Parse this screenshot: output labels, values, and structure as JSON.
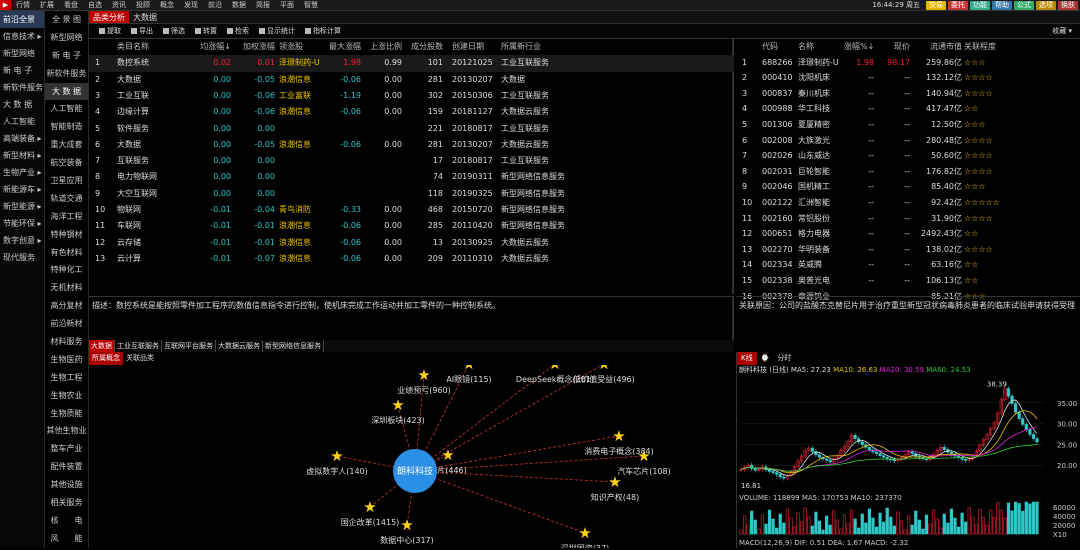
{
  "menu": {
    "items": [
      "行情",
      "扩展",
      "看盘",
      "自选",
      "资讯",
      "投顾",
      "概念",
      "发现",
      "前沿",
      "数据",
      "简报",
      "平面",
      "智慧"
    ],
    "time": "16:44:29 周五",
    "buttons": [
      {
        "label": "交易",
        "color": "#e6b800"
      },
      {
        "label": "委托",
        "color": "#c33"
      },
      {
        "label": "功能",
        "color": "#3a8"
      },
      {
        "label": "帮助",
        "color": "#37a"
      },
      {
        "label": "公式",
        "color": "#3a6"
      },
      {
        "label": "选项",
        "color": "#b80"
      },
      {
        "label": "换肤",
        "color": "#a33"
      }
    ]
  },
  "leftnav": {
    "items": [
      "前沿全景",
      "信息技术 ▸",
      "新型网络",
      "新 电 子",
      "新软件服务",
      "大 数 据",
      "人工智能",
      "高端装备 ▸",
      "新型材料 ▸",
      "生物产业 ▸",
      "新能源车 ▸",
      "新型能源 ▸",
      "节能环保 ▸",
      "数字创意 ▸",
      "现代服务"
    ],
    "active": 0
  },
  "concepts": {
    "items": [
      "全 景 图",
      "新型网络",
      "新 电 子",
      "新软件服务",
      "大 数 据",
      "人工智能",
      "智能制造",
      "重大成套",
      "航空装备",
      "卫星应用",
      "轨道交通",
      "海洋工程",
      "特种钢材",
      "有色材料",
      "特种化工",
      "无机材料",
      "高分复材",
      "前沿新材",
      "材料服务",
      "生物医药",
      "生物工程",
      "生物农业",
      "生物质能",
      "其他生物业",
      "整车产业",
      "配件装置",
      "其他设施",
      "相关服务",
      "核　　电",
      "风　　能"
    ],
    "active": 4
  },
  "tabs": [
    {
      "label": "品类分析",
      "active": true
    },
    {
      "label": "大数据",
      "active": false
    }
  ],
  "toolbar": {
    "buttons": [
      "提取",
      "导出",
      "筛选",
      "转置",
      "检索",
      "显示统计",
      "指标计算"
    ],
    "close": "收藏 ▾"
  },
  "left_table": {
    "headers": [
      "",
      "类目名称",
      "均涨幅↓",
      "加权涨幅",
      "领涨股",
      "最大涨幅",
      "上涨比例",
      "成分股数",
      "创建日期",
      "所属新行业"
    ],
    "rows": [
      [
        "1",
        "数控系统",
        "0.02",
        "0.01",
        "泽璟制药-U",
        "1.98",
        "0.99",
        "101",
        "20121025",
        "工业互联服务"
      ],
      [
        "2",
        "大数据",
        "0.00",
        "-0.05",
        "浪潮信息",
        "-0.06",
        "0.00",
        "281",
        "20130207",
        "大数据"
      ],
      [
        "3",
        "工业互联",
        "0.00",
        "-0.06",
        "工业富联",
        "-1.19",
        "0.00",
        "302",
        "20150306",
        "工业互联服务"
      ],
      [
        "4",
        "边缘计算",
        "0.00",
        "-0.06",
        "浪潮信息",
        "-0.06",
        "0.00",
        "159",
        "20181127",
        "大数据云服务"
      ],
      [
        "5",
        "软件服务",
        "0.00",
        "0.00",
        "",
        "",
        "",
        "221",
        "20180817",
        "工业互联服务"
      ],
      [
        "6",
        "大数据",
        "0.00",
        "-0.05",
        "浪潮信息",
        "-0.06",
        "0.00",
        "281",
        "20130207",
        "大数据云服务"
      ],
      [
        "7",
        "互联服务",
        "0.00",
        "0.00",
        "",
        "",
        "",
        "17",
        "20180817",
        "工业互联服务"
      ],
      [
        "8",
        "电力物联网",
        "0.00",
        "0.00",
        "",
        "",
        "",
        "74",
        "20190311",
        "新型网络信息服务"
      ],
      [
        "9",
        "大空互联网",
        "0.00",
        "0.00",
        "",
        "",
        "",
        "118",
        "20190325",
        "新型网络信息服务"
      ],
      [
        "10",
        "物联网",
        "-0.01",
        "-0.04",
        "青鸟消防",
        "-0.33",
        "0.00",
        "468",
        "20150720",
        "新型网络信息服务"
      ],
      [
        "11",
        "车联网",
        "-0.01",
        "-0.01",
        "浪潮信息",
        "-0.06",
        "0.00",
        "285",
        "20110420",
        "新型网络信息服务"
      ],
      [
        "12",
        "云存储",
        "-0.01",
        "-0.01",
        "浪潮信息",
        "-0.06",
        "0.00",
        "13",
        "20130925",
        "大数据云服务"
      ],
      [
        "13",
        "云计算",
        "-0.01",
        "-0.07",
        "浪潮信息",
        "-0.06",
        "0.00",
        "209",
        "20110310",
        "大数据云服务"
      ]
    ]
  },
  "right_table": {
    "headers": [
      "",
      "代码",
      "名称",
      "涨幅%↓",
      "现价",
      "流通市值",
      "关联程度"
    ],
    "rows": [
      [
        "1",
        "688266",
        "泽璟制药-U",
        "1.98",
        "98.17",
        "259.86亿",
        "☆☆☆"
      ],
      [
        "2",
        "000410",
        "沈阳机床",
        "--",
        "--",
        "132.12亿",
        "☆☆☆☆"
      ],
      [
        "3",
        "000837",
        "秦川机床",
        "--",
        "--",
        "140.94亿",
        "☆☆☆☆"
      ],
      [
        "4",
        "000988",
        "华工科技",
        "--",
        "--",
        "417.47亿",
        "☆☆"
      ],
      [
        "5",
        "001306",
        "夏厦精密",
        "--",
        "--",
        "12.50亿",
        "☆☆☆"
      ],
      [
        "6",
        "002008",
        "大族激光",
        "--",
        "--",
        "280.48亿",
        "☆☆☆☆"
      ],
      [
        "7",
        "002026",
        "山东威达",
        "--",
        "--",
        "50.60亿",
        "☆☆☆☆"
      ],
      [
        "8",
        "002031",
        "巨轮智能",
        "--",
        "--",
        "176.82亿",
        "☆☆☆☆"
      ],
      [
        "9",
        "002046",
        "国机精工",
        "--",
        "--",
        "85.40亿",
        "☆☆☆"
      ],
      [
        "10",
        "002122",
        "汇洲智能",
        "--",
        "--",
        "92.42亿",
        "☆☆☆☆☆"
      ],
      [
        "11",
        "002160",
        "常铝股份",
        "--",
        "--",
        "31.90亿",
        "☆☆☆☆"
      ],
      [
        "12",
        "000651",
        "格力电器",
        "--",
        "--",
        "2492.43亿",
        "☆☆"
      ],
      [
        "13",
        "002270",
        "华明装备",
        "--",
        "--",
        "138.02亿",
        "☆☆☆☆"
      ],
      [
        "14",
        "002334",
        "英威腾",
        "--",
        "--",
        "63.16亿",
        "☆☆"
      ],
      [
        "15",
        "002338",
        "奥普光电",
        "--",
        "--",
        "106.13亿",
        "☆☆"
      ],
      [
        "16",
        "002378",
        "章源钨业",
        "--",
        "--",
        "85.21亿",
        "☆☆☆"
      ]
    ]
  },
  "desc_left": "描述：数控系统是能按照零件加工程序的数值信息指令进行控制，使机床完成工作运动并加工零件的一种控制系统。",
  "desc_right": "关联原因：公司的盐酸杰克替尼片用于治疗重型新型冠状病毒肺炎患者的临床试验申请获得受理",
  "tags": [
    "大数据",
    "工业互联服务",
    "互联网平台服务",
    "大数据云服务",
    "新型网络信息服务"
  ],
  "subtabs": [
    "所属概念",
    "关联品类"
  ],
  "graph": {
    "center": "朗科科技",
    "nodes": [
      {
        "label": "AI眼镜(115)"
      },
      {
        "label": "DeepSeek概念(201)"
      },
      {
        "label": "低价值受益(496)"
      },
      {
        "label": "业绩预亏(960)"
      },
      {
        "label": "深圳板块(423)"
      },
      {
        "label": "消费电子概念(384)"
      },
      {
        "label": "汽车芯片(108)"
      },
      {
        "label": "虚拟数字人(140)"
      },
      {
        "label": "芯片(446)"
      },
      {
        "label": "知识产权(48)"
      },
      {
        "label": "国企改革(1415)"
      },
      {
        "label": "数据中心(317)"
      },
      {
        "label": "深圳国资(37)"
      }
    ]
  },
  "kchart": {
    "tabs": [
      "K线",
      "⌚",
      "分时"
    ],
    "title": "朗科科技 (日线)",
    "ma": [
      {
        "label": "MA5: 27.23",
        "color": "#ddd"
      },
      {
        "label": "MA10: 26.63",
        "color": "#e8c500"
      },
      {
        "label": "MA20: 30.59",
        "color": "#d2d"
      },
      {
        "label": "MA60: 24.53",
        "color": "#3c3"
      }
    ],
    "high": "38.39",
    "low": "16.81",
    "yticks": [
      "35.00",
      "30.00",
      "25.00",
      "20.00"
    ],
    "vol": "VOLUME: 118899  MA5: 170753  MA10: 237370",
    "vticks": [
      "60000",
      "40000",
      "20000",
      "X10"
    ],
    "macd": "MACD(12,26,9)  DIF: 0.51  DEA: 1.67  MACD: -2.32",
    "closes": [
      19,
      19.5,
      20,
      19.2,
      18.8,
      19,
      19.6,
      18.9,
      18.5,
      18.2,
      17.8,
      17.2,
      16.9,
      17.5,
      18.4,
      19.6,
      21,
      22.2,
      23.6,
      24.1,
      23.3,
      22.5,
      21.9,
      21.5,
      21.2,
      20.8,
      21.5,
      22.3,
      23.6,
      24.5,
      25.7,
      27.2,
      26.4,
      25.6,
      24.9,
      24.3,
      23.7,
      23.2,
      22.8,
      22.3,
      21.9,
      21.5,
      21.3,
      21.1,
      21.4,
      21.8,
      22.5,
      23.2,
      22.8,
      22.2,
      21.9,
      21.6,
      21.3,
      21.8,
      22.6,
      23.5,
      24.3,
      23.8,
      23.1,
      22.6,
      22.2,
      21.8,
      21.4,
      21.2,
      21.5,
      22.3,
      23.4,
      24.8,
      26.1,
      27.3,
      28.8,
      30.2,
      32.5,
      35.8,
      38.4,
      36.6,
      34.8,
      32.7,
      31.2,
      29.8,
      28.6,
      27.4,
      26.4,
      25.6
    ]
  }
}
